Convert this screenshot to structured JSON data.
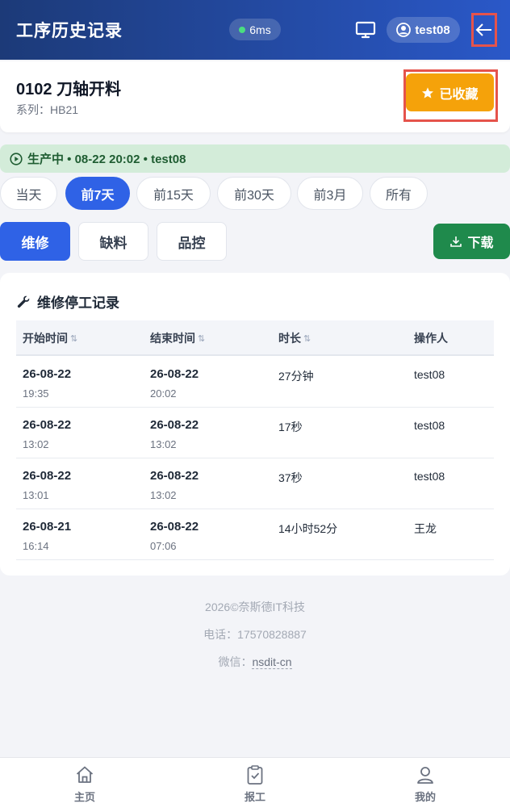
{
  "header": {
    "title": "工序历史记录",
    "latency": "6ms",
    "username": "test08"
  },
  "process": {
    "name": "0102 刀轴开料",
    "series": "系列：HB21",
    "favorite_label": "已收藏"
  },
  "status": {
    "text": "生产中 • 08-22 20:02 • test08"
  },
  "ranges": [
    "当天",
    "前7天",
    "前15天",
    "前30天",
    "前3月",
    "所有"
  ],
  "active_range": "前7天",
  "types": [
    "维修",
    "缺料",
    "品控"
  ],
  "active_type": "维修",
  "download_label": "下载",
  "table": {
    "title": "维修停工记录",
    "columns": [
      "开始时间",
      "结束时间",
      "时长",
      "操作人"
    ],
    "rows": [
      {
        "start_date": "26-08-22",
        "start_time": "19:35",
        "end_date": "26-08-22",
        "end_time": "20:02",
        "duration": "27分钟",
        "operator": "test08"
      },
      {
        "start_date": "26-08-22",
        "start_time": "13:02",
        "end_date": "26-08-22",
        "end_time": "13:02",
        "duration": "17秒",
        "operator": "test08"
      },
      {
        "start_date": "26-08-22",
        "start_time": "13:01",
        "end_date": "26-08-22",
        "end_time": "13:02",
        "duration": "37秒",
        "operator": "test08"
      },
      {
        "start_date": "26-08-21",
        "start_time": "16:14",
        "end_date": "26-08-22",
        "end_time": "07:06",
        "duration": "14小时52分",
        "operator": "王龙"
      }
    ]
  },
  "footer": {
    "copyright": "2026©奈斯德IT科技",
    "phone": "电话：17570828887",
    "wechat_label": "微信：",
    "wechat_id": "nsdit-cn"
  },
  "nav": {
    "home": "主页",
    "report": "报工",
    "mine": "我的"
  },
  "colors": {
    "header_start": "#1c3a78",
    "header_end": "#2a58c8",
    "primary": "#2f62e6",
    "favorite": "#f5a20a",
    "download": "#1f8a4c",
    "status_bg": "#d3ecd9",
    "highlight_border": "#e5534b"
  }
}
